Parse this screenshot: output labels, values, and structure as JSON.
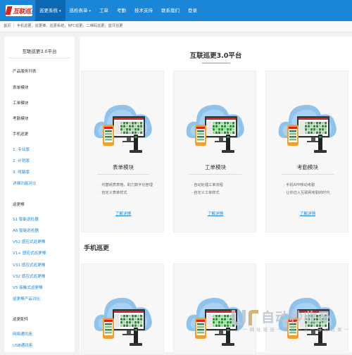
{
  "logo": {
    "text": "互联巡更"
  },
  "nav": {
    "items": [
      {
        "label": "巡更系统",
        "caret": "▾"
      },
      {
        "label": "巡检表单",
        "caret": "▾"
      },
      {
        "label": "工单"
      },
      {
        "label": "考勤"
      },
      {
        "label": "技术支持"
      },
      {
        "label": "联系我们"
      },
      {
        "label": "登录"
      }
    ],
    "active_color": "#0e67b3",
    "bar_color": "#1a86d8"
  },
  "breadcrumb": "首页 ｜ 手机巡更，巡更棒，巡更系统，NFC巡更，二维码巡更，蓝牙巡更",
  "sidebar": {
    "title": "互联巡更3.0平台",
    "items": [
      {
        "label": "产品服务列表",
        "kind": "head"
      },
      {
        "label": "表单模块",
        "kind": "head"
      },
      {
        "label": "工单模块",
        "kind": "head"
      },
      {
        "label": "考勤模块",
        "kind": "head"
      },
      {
        "label": "手机巡更",
        "kind": "head"
      },
      {
        "label": "1. 专业版",
        "kind": "link"
      },
      {
        "label": "2. 计划版",
        "kind": "link"
      },
      {
        "label": "3. 线路版",
        "kind": "link"
      },
      {
        "label": "详细功能对比",
        "kind": "link"
      },
      {
        "label": "巡更棒",
        "kind": "head"
      },
      {
        "label": "S1  智能巡检器",
        "kind": "link"
      },
      {
        "label": "A6  智能巡检器",
        "kind": "link"
      },
      {
        "label": "V52  感应式巡更棒",
        "kind": "link"
      },
      {
        "label": "V1+  感应式巡更棒",
        "kind": "link"
      },
      {
        "label": "V31  感应式巡更棒",
        "kind": "link"
      },
      {
        "label": "V32  感应式巡更棒",
        "kind": "link"
      },
      {
        "label": "V5  接触式巡更棒",
        "kind": "link"
      },
      {
        "label": "巡更棒产品对比",
        "kind": "link"
      },
      {
        "label": "巡更配件",
        "kind": "head"
      },
      {
        "label": "网络通讯座",
        "kind": "link"
      },
      {
        "label": "USB通讯座",
        "kind": "link"
      }
    ]
  },
  "main": {
    "title": "互联巡更3.0平台",
    "cards": [
      {
        "name": "表单模块",
        "features": [
          "· 代替纸质表格，助力数字化管理",
          "· 自定义表单样式"
        ],
        "more": "了解详情"
      },
      {
        "name": "工单模块",
        "features": [
          "· 自动处理工单流程",
          "· 自定义工单样式"
        ],
        "more": "了解详情"
      },
      {
        "name": "考勤模块",
        "features": [
          "· 手机APP移动考勤",
          "· 让你迈入互联网考勤的时代"
        ],
        "more": "了解详情"
      }
    ],
    "section_title": "手机巡更"
  },
  "watermark": {
    "big": "自动秒收录",
    "small": "一 网 址 链 接 一 来 访 一 次 一 自 动 收 录 一"
  }
}
